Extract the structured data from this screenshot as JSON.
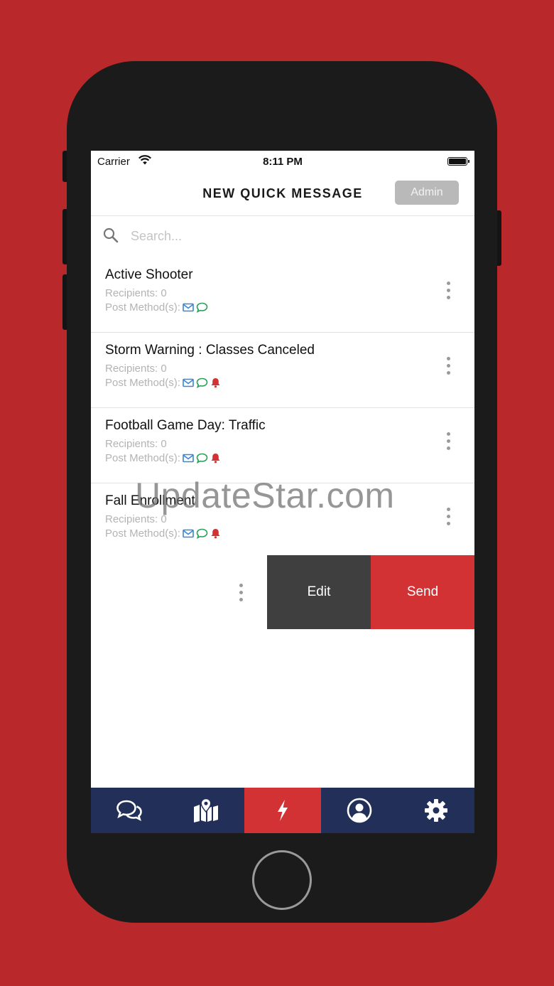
{
  "status_bar": {
    "carrier": "Carrier",
    "time": "8:11 PM"
  },
  "header": {
    "title": "NEW QUICK MESSAGE",
    "admin_label": "Admin"
  },
  "search": {
    "placeholder": "Search..."
  },
  "messages": [
    {
      "title": "Active Shooter",
      "recipients": "Recipients: 0",
      "post_methods_label": "Post Method(s):",
      "methods": [
        "email-icon",
        "chat-icon"
      ]
    },
    {
      "title": "Storm Warning : Classes Canceled",
      "recipients": "Recipients: 0",
      "post_methods_label": "Post Method(s):",
      "methods": [
        "email-icon",
        "chat-icon",
        "bell-icon"
      ]
    },
    {
      "title": "Football Game Day: Traffic",
      "recipients": "Recipients: 0",
      "post_methods_label": "Post Method(s):",
      "methods": [
        "email-icon",
        "chat-icon",
        "bell-icon"
      ]
    },
    {
      "title": "Fall Enrollment",
      "recipients": "Recipients: 0",
      "post_methods_label": "Post Method(s):",
      "methods": [
        "email-icon",
        "chat-icon",
        "bell-icon"
      ]
    }
  ],
  "swipe_actions": {
    "edit_label": "Edit",
    "send_label": "Send"
  },
  "tab_bar": {
    "tabs": [
      "chat-bubbles-icon",
      "map-icon",
      "lightning-icon",
      "profile-icon",
      "gear-icon"
    ],
    "active_index": 2
  },
  "watermark": "UpdateStar.com",
  "colors": {
    "background": "#b9282a",
    "accent_red": "#d33235",
    "nav_blue": "#223059",
    "email_blue": "#3a86d4",
    "chat_green": "#2aa05a",
    "bell_red": "#d33235"
  }
}
